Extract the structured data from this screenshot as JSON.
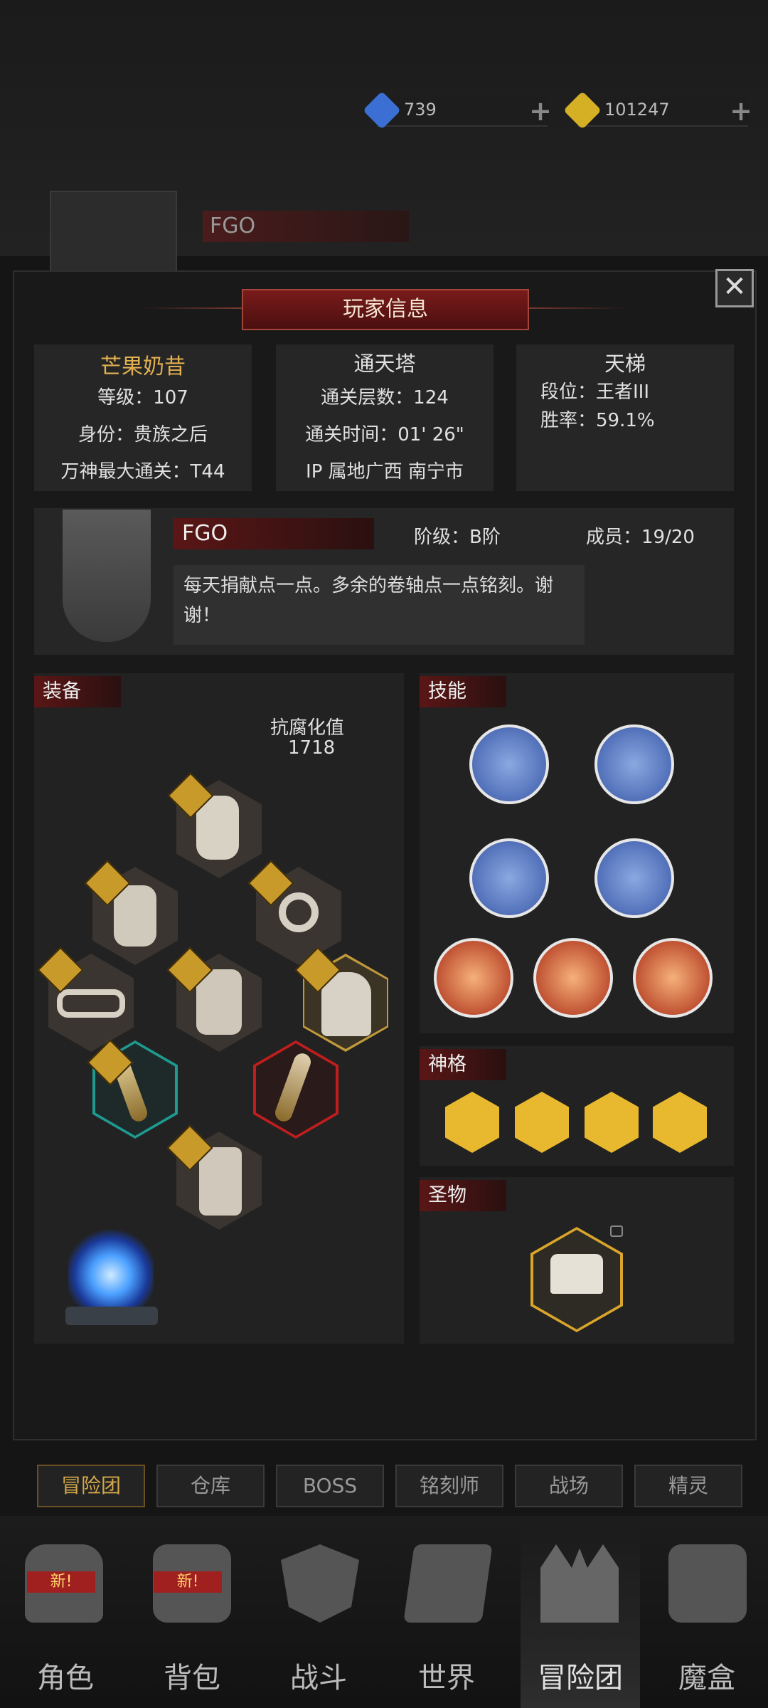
{
  "resources": [
    {
      "value": "739",
      "color": "#3b6fd4"
    },
    {
      "value": "101247",
      "color": "#d6b024"
    }
  ],
  "background": {
    "name": "FGO"
  },
  "dialog": {
    "title": "玩家信息",
    "close_label": "✕",
    "player": {
      "name": "芒果奶昔",
      "level": "等级：107",
      "identity": "身份：贵族之后",
      "max_clear": "万神最大通关：T44"
    },
    "tower": {
      "title": "通天塔",
      "floors": "通关层数：124",
      "time": "通关时间：01' 26\"",
      "ip": "IP 属地广西 南宁市"
    },
    "ladder": {
      "title": "天梯",
      "rank": "段位：王者III",
      "winrate": "胜率：59.1%"
    },
    "guild": {
      "name": "FGO",
      "tier": "阶级：B阶",
      "members": "成员：19/20",
      "notice": "每天捐献点一点。多余的卷轴点一点铭刻。谢谢！"
    },
    "equipment": {
      "label": "装备",
      "stat_label": "抗腐化值",
      "stat_value": "1718"
    },
    "skills": {
      "label": "技能"
    },
    "divinity": {
      "label": "神格"
    },
    "relic": {
      "label": "圣物"
    }
  },
  "tabs": [
    "冒险团",
    "仓库",
    "BOSS",
    "铭刻师",
    "战场",
    "精灵"
  ],
  "nav": [
    "角色",
    "背包",
    "战斗",
    "世界",
    "冒险团",
    "魔盒"
  ],
  "nav_badge": "新!"
}
